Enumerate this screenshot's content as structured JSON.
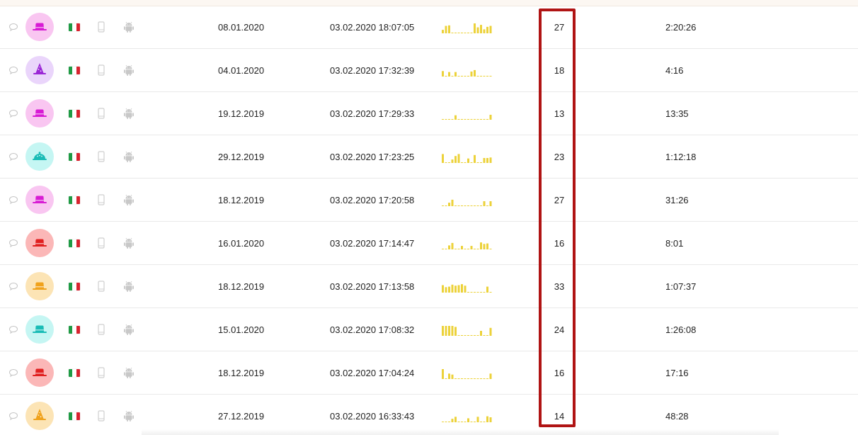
{
  "colors": {
    "spark_bar": "#ecd23a",
    "highlight_border": "#b01414",
    "flag_green": "#1f9b45",
    "flag_white": "#ffffff",
    "flag_red": "#d8232f",
    "icon_gray": "#c8c8c8"
  },
  "icons": {
    "chat": "speech-bubble",
    "device": "smartphone",
    "os": "android",
    "flag": "italy-flag"
  },
  "rows": [
    {
      "avatar": {
        "shape": "hat",
        "bg": "#f9c6f1",
        "fg": "#d81bd4"
      },
      "first_date": "08.01.2020",
      "last_date": "03.02.2020 18:07:05",
      "count": "27",
      "duration": "2:20:26",
      "sparkline": [
        0.35,
        0.75,
        0.8,
        0,
        0,
        0,
        0,
        0,
        0,
        0,
        1.0,
        0.6,
        0.85,
        0.4,
        0.65,
        0.75
      ]
    },
    {
      "avatar": {
        "shape": "witch",
        "bg": "#ead5fb",
        "fg": "#9a26d6"
      },
      "first_date": "04.01.2020",
      "last_date": "03.02.2020 17:32:39",
      "count": "18",
      "duration": "4:16",
      "sparkline": [
        0.55,
        0,
        0.45,
        0,
        0.45,
        0,
        0,
        0,
        0,
        0.5,
        0.65,
        0,
        0,
        0,
        0,
        0
      ]
    },
    {
      "avatar": {
        "shape": "hat",
        "bg": "#f9c6f1",
        "fg": "#d81bd4"
      },
      "first_date": "19.12.2019",
      "last_date": "03.02.2020 17:29:33",
      "count": "13",
      "duration": "13:35",
      "sparkline": [
        0,
        0,
        0,
        0,
        0.45,
        0,
        0,
        0,
        0,
        0,
        0,
        0,
        0,
        0,
        0,
        0.5
      ]
    },
    {
      "avatar": {
        "shape": "cloche",
        "bg": "#c5f6f3",
        "fg": "#19bcb6"
      },
      "first_date": "29.12.2019",
      "last_date": "03.02.2020 17:23:25",
      "count": "23",
      "duration": "1:12:18",
      "sparkline": [
        0.9,
        0,
        0,
        0.35,
        0.7,
        0.9,
        0,
        0,
        0.45,
        0,
        0.8,
        0,
        0,
        0.5,
        0.5,
        0.55
      ]
    },
    {
      "avatar": {
        "shape": "hat",
        "bg": "#f9c6f1",
        "fg": "#d81bd4"
      },
      "first_date": "18.12.2019",
      "last_date": "03.02.2020 17:20:58",
      "count": "27",
      "duration": "31:26",
      "sparkline": [
        0,
        0,
        0.35,
        0.65,
        0,
        0,
        0,
        0,
        0,
        0,
        0,
        0,
        0,
        0.5,
        0,
        0.5
      ]
    },
    {
      "avatar": {
        "shape": "hat",
        "bg": "#fbb7b7",
        "fg": "#e02020"
      },
      "first_date": "16.01.2020",
      "last_date": "03.02.2020 17:14:47",
      "count": "16",
      "duration": "8:01",
      "sparkline": [
        0,
        0,
        0.4,
        0.65,
        0,
        0,
        0.35,
        0,
        0,
        0.35,
        0,
        0,
        0.7,
        0.55,
        0.6,
        0
      ]
    },
    {
      "avatar": {
        "shape": "hat",
        "bg": "#fce4b5",
        "fg": "#f0a21c"
      },
      "first_date": "18.12.2019",
      "last_date": "03.02.2020 17:13:58",
      "count": "33",
      "duration": "1:07:37",
      "sparkline": [
        0.75,
        0.55,
        0.6,
        0.8,
        0.7,
        0.75,
        0.85,
        0.7,
        0,
        0,
        0,
        0,
        0,
        0,
        0.6,
        0
      ]
    },
    {
      "avatar": {
        "shape": "hat",
        "bg": "#c5f6f3",
        "fg": "#19bcb6"
      },
      "first_date": "15.01.2020",
      "last_date": "03.02.2020 17:08:32",
      "count": "24",
      "duration": "1:26:08",
      "sparkline": [
        1.0,
        1.0,
        1.0,
        1.0,
        0.9,
        0,
        0,
        0,
        0,
        0,
        0,
        0,
        0.5,
        0,
        0,
        0.8
      ]
    },
    {
      "avatar": {
        "shape": "hat",
        "bg": "#fbb7b7",
        "fg": "#e02020"
      },
      "first_date": "18.12.2019",
      "last_date": "03.02.2020 17:04:24",
      "count": "16",
      "duration": "17:16",
      "sparkline": [
        1.0,
        0,
        0.55,
        0.45,
        0,
        0,
        0,
        0,
        0,
        0,
        0,
        0,
        0,
        0,
        0,
        0.55
      ]
    },
    {
      "avatar": {
        "shape": "witch",
        "bg": "#fce4b5",
        "fg": "#f0a21c"
      },
      "first_date": "27.12.2019",
      "last_date": "03.02.2020 16:33:43",
      "count": "14",
      "duration": "48:28",
      "sparkline": [
        0,
        0,
        0,
        0.35,
        0.55,
        0,
        0,
        0,
        0.4,
        0,
        0,
        0.55,
        0,
        0,
        0.6,
        0.5
      ]
    }
  ]
}
